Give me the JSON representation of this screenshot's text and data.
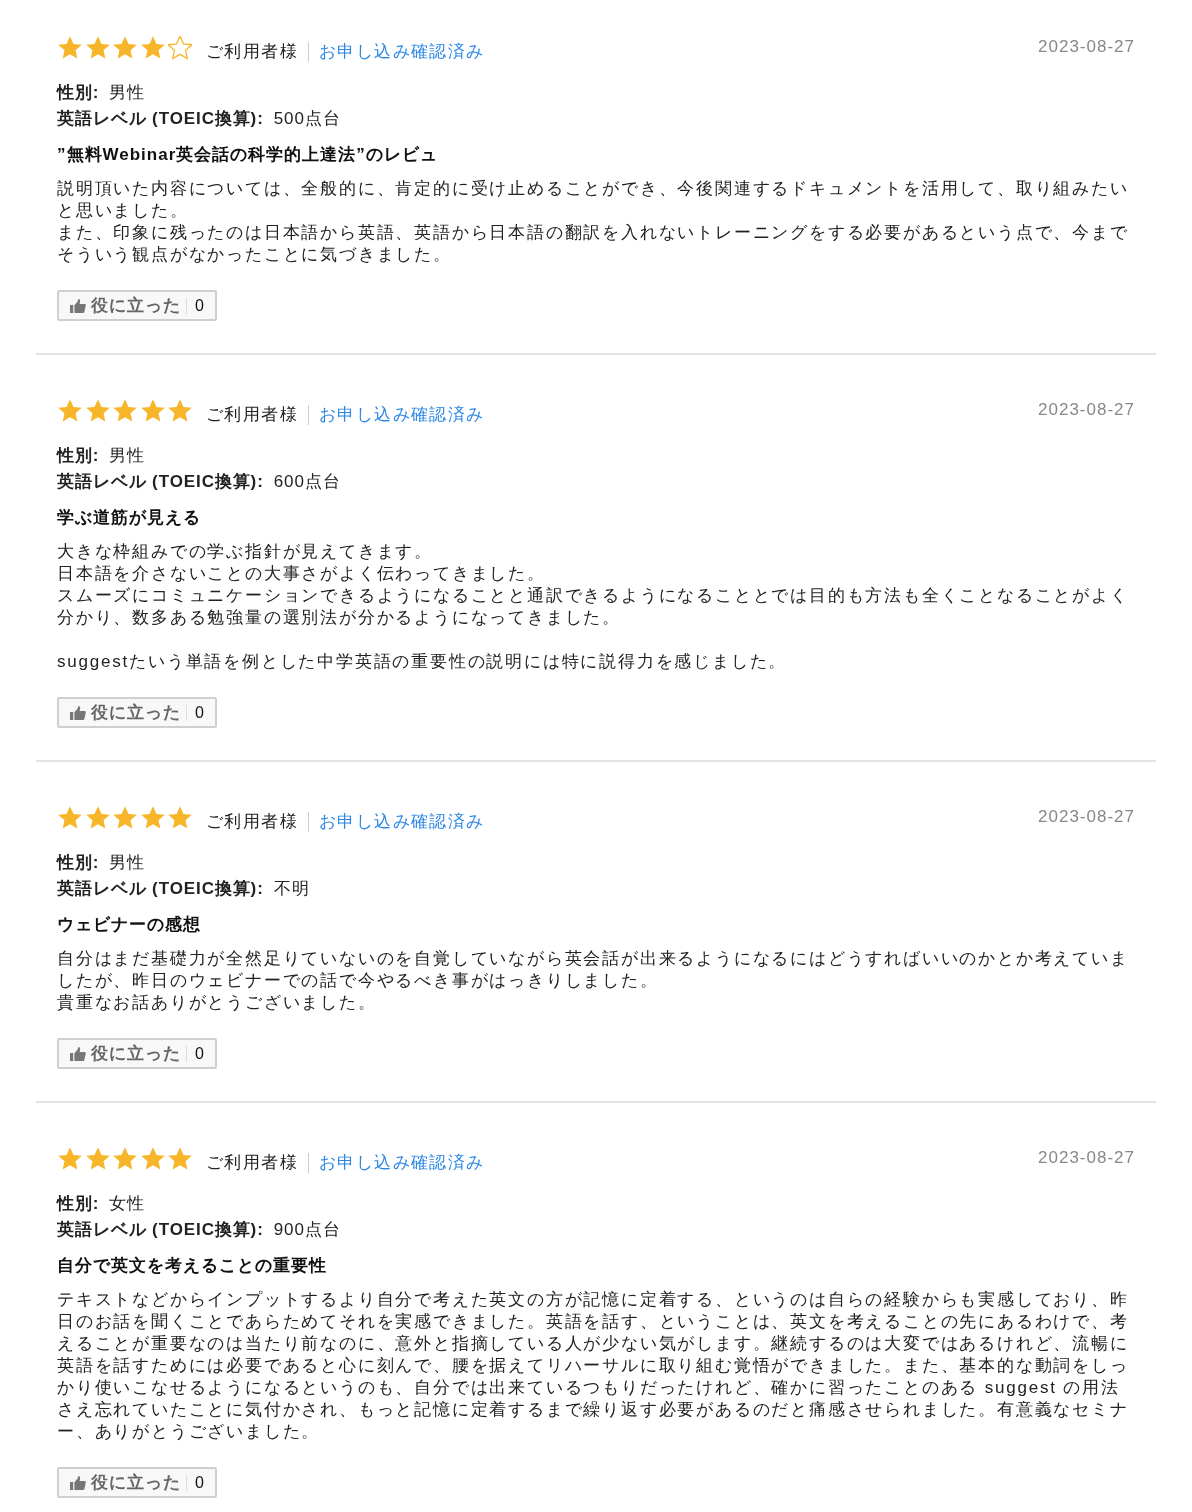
{
  "reviews": [
    {
      "stars": 4,
      "author": "ご利用者様",
      "verified": "お申し込み確認済み",
      "date": "2023-08-27",
      "gender": {
        "label": "性別:",
        "value": "男性"
      },
      "level": {
        "label": "英語レベル (TOEIC換算):",
        "value": "500点台"
      },
      "title": "”無料Webinar英会話の科学的上達法”のレビュ",
      "body": [
        [
          "説明頂いた内容については、全般的に、肯定的に受け止めることができ、今後関連するドキュメントを活用して、取り組みたいと思いました。",
          "また、印象に残ったのは日本語から英語、英語から日本語の翻訳を入れないトレーニングをする必要があるという点で、今までそういう観点がなかったことに気づきました。"
        ]
      ],
      "helpful": {
        "label": "役に立った",
        "count": "0"
      }
    },
    {
      "stars": 5,
      "author": "ご利用者様",
      "verified": "お申し込み確認済み",
      "date": "2023-08-27",
      "gender": {
        "label": "性別:",
        "value": "男性"
      },
      "level": {
        "label": "英語レベル (TOEIC換算):",
        "value": "600点台"
      },
      "title": "学ぶ道筋が見える",
      "body": [
        [
          "大きな枠組みでの学ぶ指針が見えてきます。",
          "日本語を介さないことの大事さがよく伝わってきました。",
          "スムーズにコミュニケーションできるようになることと通訳できるようになることとでは目的も方法も全くことなることがよく分かり、数多ある勉強量の選別法が分かるようになってきました。"
        ],
        [
          "suggestたいう単語を例とした中学英語の重要性の説明には特に説得力を感じました。"
        ]
      ],
      "helpful": {
        "label": "役に立った",
        "count": "0"
      }
    },
    {
      "stars": 5,
      "author": "ご利用者様",
      "verified": "お申し込み確認済み",
      "date": "2023-08-27",
      "gender": {
        "label": "性別:",
        "value": "男性"
      },
      "level": {
        "label": "英語レベル (TOEIC換算):",
        "value": "不明"
      },
      "title": "ウェビナーの感想",
      "body": [
        [
          "自分はまだ基礎力が全然足りていないのを自覚していながら英会話が出来るようになるにはどうすればいいのかとか考えていましたが、昨日のウェビナーでの話で今やるべき事がはっきりしました。",
          "貴重なお話ありがとうございました。"
        ]
      ],
      "helpful": {
        "label": "役に立った",
        "count": "0"
      }
    },
    {
      "stars": 5,
      "author": "ご利用者様",
      "verified": "お申し込み確認済み",
      "date": "2023-08-27",
      "gender": {
        "label": "性別:",
        "value": "女性"
      },
      "level": {
        "label": "英語レベル (TOEIC換算):",
        "value": "900点台"
      },
      "title": "自分で英文を考えることの重要性",
      "body": [
        [
          "テキストなどからインプットするより自分で考えた英文の方が記憶に定着する、というのは自らの経験からも実感しており、昨日のお話を聞くことであらためてそれを実感できました。英語を話す、ということは、英文を考えることの先にあるわけで、考えることが重要なのは当たり前なのに、意外と指摘している人が少ない気がします。継続するのは大変ではあるけれど、流暢に英語を話すためには必要であると心に刻んで、腰を据えてリハーサルに取り組む覚悟ができました。また、基本的な動詞をしっかり使いこなせるようになるというのも、自分では出来ているつもりだったけれど、確かに習ったことのある suggest の用法さえ忘れていたことに気付かされ、もっと記憶に定着するまで繰り返す必要があるのだと痛感させられました。有意義なセミナー、ありがとうございました。"
        ]
      ],
      "helpful": {
        "label": "役に立った",
        "count": "0"
      }
    }
  ]
}
